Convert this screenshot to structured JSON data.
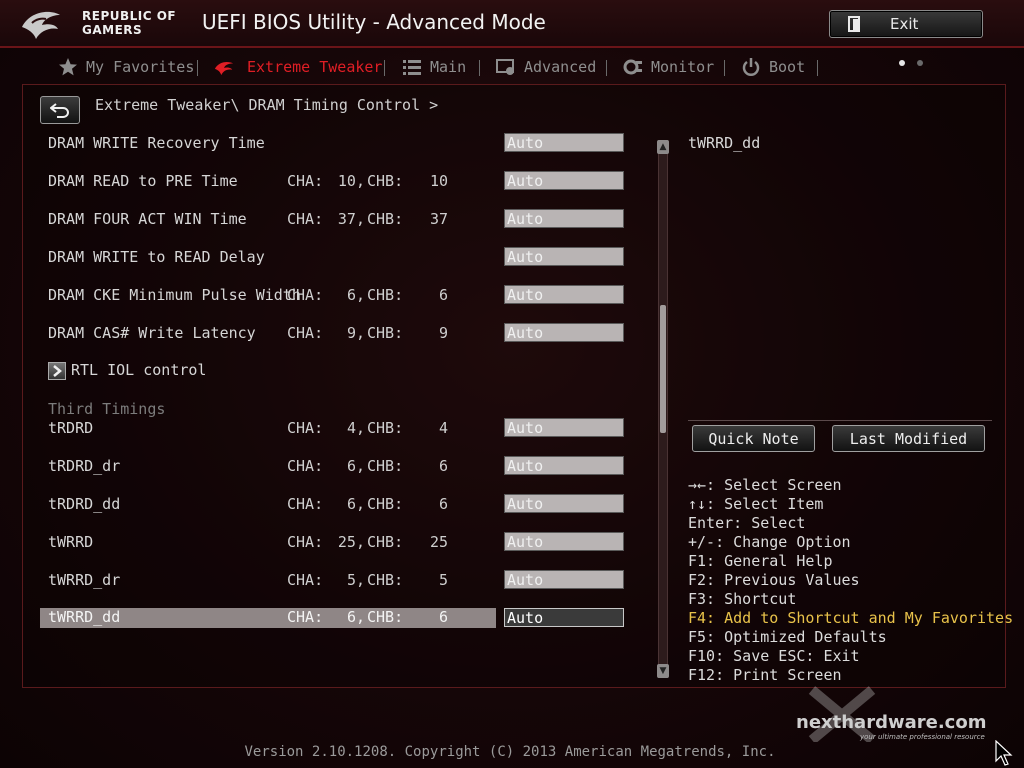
{
  "header": {
    "brand_line1": "REPUBLIC OF",
    "brand_line2": "GAMERS",
    "title": "UEFI BIOS Utility - Advanced Mode",
    "exit_label": "Exit"
  },
  "nav": {
    "tabs": [
      {
        "label": "My Favorites",
        "icon": "star-icon",
        "active": false
      },
      {
        "label": "Extreme Tweaker",
        "icon": "rog-eye-icon",
        "active": true
      },
      {
        "label": "Main",
        "icon": "list-icon",
        "active": false
      },
      {
        "label": "Advanced",
        "icon": "advanced-icon",
        "active": false
      },
      {
        "label": "Monitor",
        "icon": "monitor-icon",
        "active": false
      },
      {
        "label": "Boot",
        "icon": "power-icon",
        "active": false
      }
    ],
    "page_dots": 2,
    "active_dot": 1
  },
  "breadcrumb": "Extreme Tweaker\\ DRAM Timing Control >",
  "settings": [
    {
      "name": "DRAM WRITE Recovery Time",
      "cha": "",
      "chb": "",
      "value": "Auto"
    },
    {
      "name": "DRAM READ to PRE Time",
      "cha": "10,",
      "chb": "10",
      "value": "Auto"
    },
    {
      "name": "DRAM FOUR ACT WIN Time",
      "cha": "37,",
      "chb": "37",
      "value": "Auto"
    },
    {
      "name": "DRAM WRITE to READ Delay",
      "cha": "",
      "chb": "",
      "value": "Auto"
    },
    {
      "name": "DRAM CKE Minimum Pulse Width",
      "cha": "6,",
      "chb": "6",
      "value": "Auto"
    },
    {
      "name": "DRAM CAS# Write Latency",
      "cha": "9,",
      "chb": "9",
      "value": "Auto"
    }
  ],
  "submenu": {
    "label": "RTL IOL control"
  },
  "section": {
    "label": "Third Timings"
  },
  "third_timings": [
    {
      "name": "tRDRD",
      "cha": "4,",
      "chb": "4",
      "value": "Auto"
    },
    {
      "name": "tRDRD_dr",
      "cha": "6,",
      "chb": "6",
      "value": "Auto"
    },
    {
      "name": "tRDRD_dd",
      "cha": "6,",
      "chb": "6",
      "value": "Auto"
    },
    {
      "name": "tWRRD",
      "cha": "25,",
      "chb": "25",
      "value": "Auto"
    },
    {
      "name": "tWRRD_dr",
      "cha": "5,",
      "chb": "5",
      "value": "Auto"
    },
    {
      "name": "tWRRD_dd",
      "cha": "6,",
      "chb": "6",
      "value": "Auto",
      "selected": true
    }
  ],
  "channel_labels": {
    "cha": "CHA:",
    "chb": "CHB:"
  },
  "help": {
    "title": "tWRRD_dd",
    "quick_note": "Quick Note",
    "last_modified": "Last Modified",
    "keys": [
      {
        "text": "→←: Select Screen"
      },
      {
        "text": "↑↓: Select Item"
      },
      {
        "text": "Enter: Select"
      },
      {
        "text": "+/-: Change Option"
      },
      {
        "text": "F1: General Help"
      },
      {
        "text": "F2: Previous Values"
      },
      {
        "text": "F3: Shortcut"
      },
      {
        "text": "F4: Add to Shortcut and My Favorites",
        "highlight": true
      },
      {
        "text": "F5: Optimized Defaults"
      },
      {
        "text": "F10: Save  ESC: Exit"
      },
      {
        "text": "F12: Print Screen"
      }
    ]
  },
  "footer": "Version 2.10.1208. Copyright (C) 2013 American Megatrends, Inc.",
  "watermark": {
    "text": "nexthardware.com",
    "sub": "your ultimate professional resource"
  },
  "colors": {
    "accent": "#e01e25",
    "field_bg": "#b9b4b4",
    "selected_row": "#8f8686",
    "highlight_key": "#e8c24a",
    "background": "#160608"
  }
}
